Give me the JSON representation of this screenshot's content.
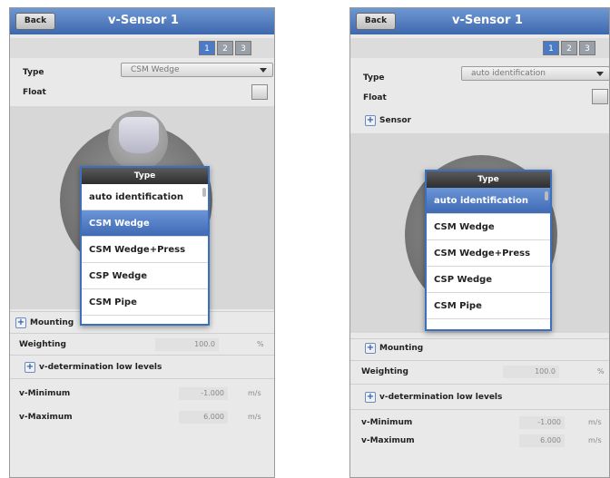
{
  "left": {
    "back_label": "Back",
    "title": "v-Sensor 1",
    "tabs": [
      "1",
      "2",
      "3"
    ],
    "type_label": "Type",
    "type_value": "CSM Wedge",
    "float_label": "Float",
    "mounting_label": "Mounting",
    "weighting_label": "Weighting",
    "weighting_value": "100.0",
    "weighting_unit": "%",
    "vdet_label": "v-determination low levels",
    "vmin_label": "v-Minimum",
    "vmin_value": "-1.000",
    "vmin_unit": "m/s",
    "vmax_label": "v-Maximum",
    "vmax_value": "6.000",
    "vmax_unit": "m/s",
    "popup": {
      "header": "Type",
      "items": [
        "auto identification",
        "CSM Wedge",
        "CSM Wedge+Press",
        "CSP Wedge",
        "CSM Pipe"
      ],
      "selected": 1
    }
  },
  "right": {
    "back_label": "Back",
    "title": "v-Sensor 1",
    "tabs": [
      "1",
      "2",
      "3"
    ],
    "type_label": "Type",
    "type_value": "auto identification",
    "float_label": "Float",
    "sensor_label": "Sensor",
    "mounting_label": "Mounting",
    "weighting_label": "Weighting",
    "weighting_value": "100.0",
    "weighting_unit": "%",
    "vdet_label": "v-determination low levels",
    "vmin_label": "v-Minimum",
    "vmin_value": "-1.000",
    "vmin_unit": "m/s",
    "vmax_label": "v-Maximum",
    "vmax_value": "6.000",
    "vmax_unit": "m/s",
    "popup": {
      "header": "Type",
      "items": [
        "auto identification",
        "CSM Wedge",
        "CSM Wedge+Press",
        "CSP Wedge",
        "CSM Pipe"
      ],
      "selected": 0
    }
  },
  "colors": {
    "titlebar": "#4a78be",
    "selection": "#4f7cc8",
    "panel_bg": "#e9e9e9"
  }
}
